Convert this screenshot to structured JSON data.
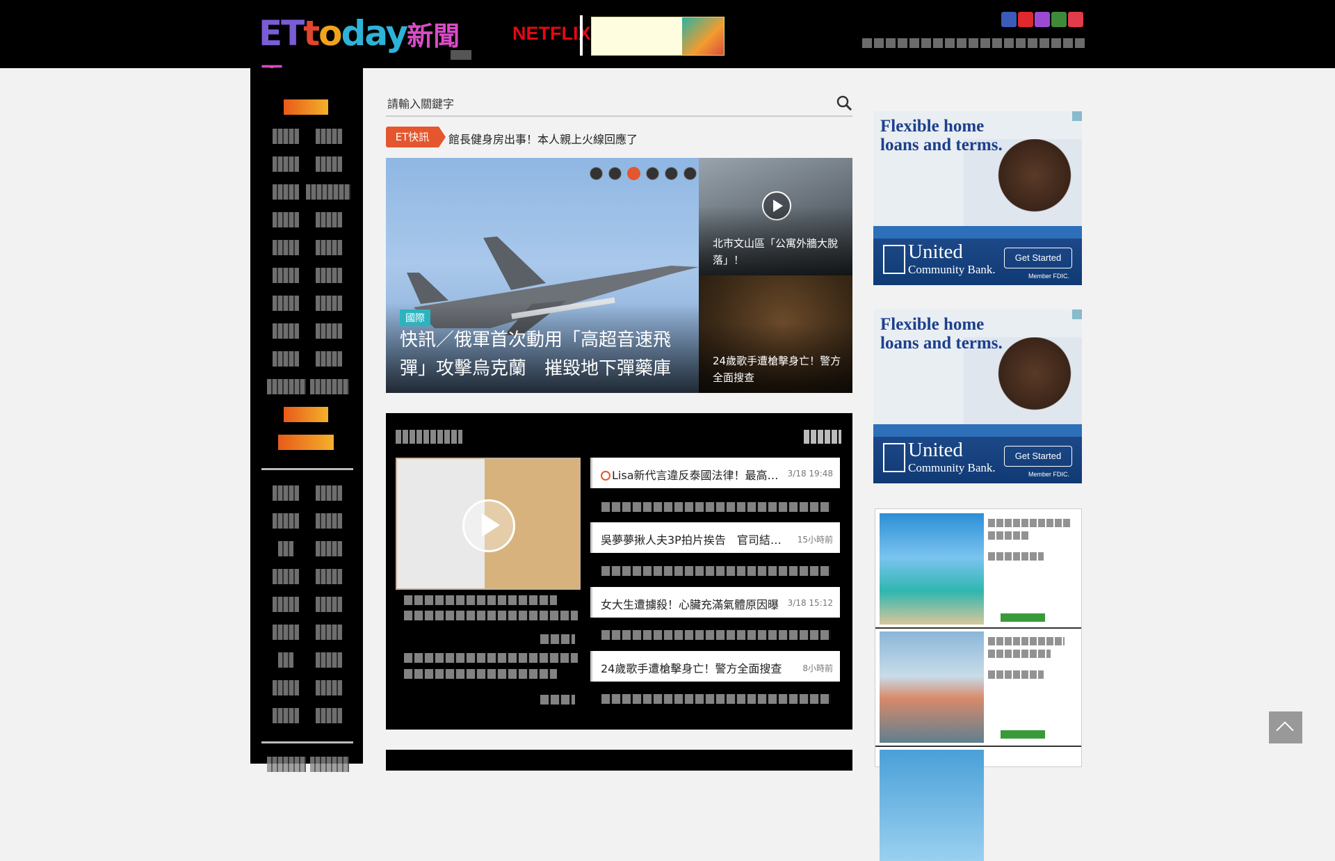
{
  "header": {
    "logo": {
      "part1": "ET",
      "part2": "t",
      "part3": "o",
      "part4": "day",
      "part5": "新聞雲"
    },
    "netflix": "NETFLIX",
    "social_colors": [
      "#3b5bb8",
      "#e0282f",
      "#9b4bd1",
      "#3f8a3a",
      "#e23b4b"
    ]
  },
  "search": {
    "placeholder": "請輸入關鍵字"
  },
  "breaking": {
    "tag": "ET快訊",
    "text": "館長健身房出事！本人親上火線回應了"
  },
  "hero": {
    "category": "國際",
    "title": "快訊／俄軍首次動用「高超音速飛彈」攻擊烏克蘭　摧毀地下彈藥庫",
    "dots": 6,
    "active_dot": 2
  },
  "side_cards": [
    {
      "title": "北市文山區「公寓外牆大脫落」！"
    },
    {
      "title": "24歲歌手遭槍擊身亡！警方全面搜查"
    }
  ],
  "video_list": [
    {
      "title": "Lisa新代言違反泰國法律！最高「…",
      "time": "3/18 19:48",
      "live": true
    },
    {
      "title": "吳夢夢揪人夫3P拍片挨告　官司結果…",
      "time": "15小時前",
      "live": false
    },
    {
      "title": "女大生遭擄殺！心臟充滿氣體原因曝",
      "time": "3/18 15:12",
      "live": false
    },
    {
      "title": "24歲歌手遭槍擊身亡！警方全面搜查",
      "time": "8小時前",
      "live": false
    }
  ],
  "ads": [
    {
      "headline": "Flexible home loans and terms.",
      "bank": "United",
      "bank_sub": "Community Bank.",
      "cta": "Get Started",
      "fdic": "Member FDIC."
    },
    {
      "headline": "Flexible home loans and terms.",
      "bank": "United",
      "bank_sub": "Community Bank.",
      "cta": "Get Started",
      "fdic": "Member FDIC."
    }
  ],
  "colors": {
    "accent": "#e4572e",
    "hero_tag": "#2bb3c0",
    "background": "#f2f2f2"
  }
}
